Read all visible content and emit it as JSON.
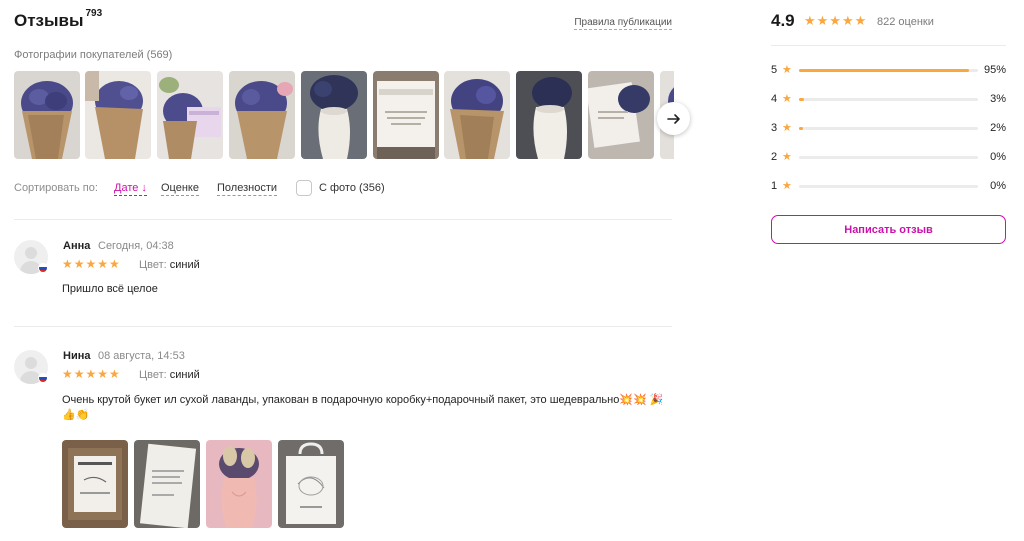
{
  "reviews_header": {
    "title": "Отзывы",
    "count": "793",
    "rules_link": "Правила публикации"
  },
  "customer_photos": {
    "label": "Фотографии покупателей (569)",
    "next_icon": "arrow-right-icon"
  },
  "sort": {
    "label": "Сортировать по:",
    "options": [
      {
        "label": "Дате",
        "suffix": "↓",
        "active": true
      },
      {
        "label": "Оценке",
        "active": false
      },
      {
        "label": "Полезности",
        "active": false
      }
    ],
    "with_photo_label": "С фото (356)",
    "with_photo_checked": false
  },
  "reviews": [
    {
      "name": "Анна",
      "date": "Сегодня, 04:38",
      "stars": "★★★★★",
      "rating": 5,
      "color_label": "Цвет:",
      "color_value": "синий",
      "text": "Пришло всё целое",
      "photos": 0
    },
    {
      "name": "Нина",
      "date": "08 августа, 14:53",
      "stars": "★★★★★",
      "rating": 5,
      "color_label": "Цвет:",
      "color_value": "синий",
      "text": "Очень крутой букет ил сухой лаванды, упакован в подарочную коробку+подарочный пакет, это шедеврально💥💥 🎉👍👏",
      "photos": 4
    }
  ],
  "rating_summary": {
    "average": "4.9",
    "stars": "★★★★★",
    "count_label": "822 оценки",
    "distribution": [
      {
        "star": "5",
        "percent": 95,
        "label": "95%"
      },
      {
        "star": "4",
        "percent": 3,
        "label": "3%"
      },
      {
        "star": "3",
        "percent": 2,
        "label": "2%"
      },
      {
        "star": "2",
        "percent": 0,
        "label": "0%"
      },
      {
        "star": "1",
        "percent": 0,
        "label": "0%"
      }
    ],
    "write_button": "Написать отзыв"
  },
  "colors": {
    "accent": "#cb11ab",
    "star": "#f9a73e",
    "muted": "#8a8a8a"
  }
}
